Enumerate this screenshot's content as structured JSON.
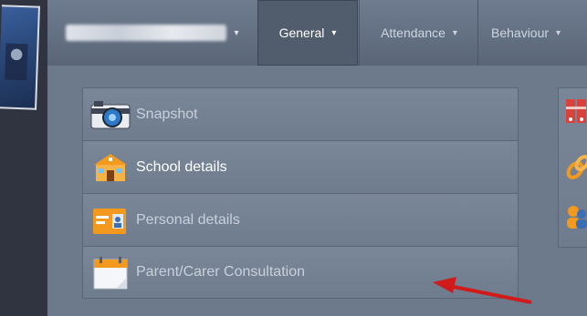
{
  "navbar": {
    "general_label": "General",
    "attendance_label": "Attendance",
    "behaviour_label": "Behaviour",
    "caret": "▾"
  },
  "menu": {
    "items": [
      {
        "label": "Snapshot",
        "icon": "camera-icon"
      },
      {
        "label": "School details",
        "icon": "school-icon"
      },
      {
        "label": "Personal details",
        "icon": "id-card-icon"
      },
      {
        "label": "Parent/Carer Consultation",
        "icon": "calendar-icon"
      }
    ]
  },
  "right_column_icons": [
    "binders-icon",
    "link-icon",
    "people-icon"
  ],
  "colors": {
    "accent_orange": "#f39a1e",
    "annotation_arrow": "#d11a1a"
  }
}
